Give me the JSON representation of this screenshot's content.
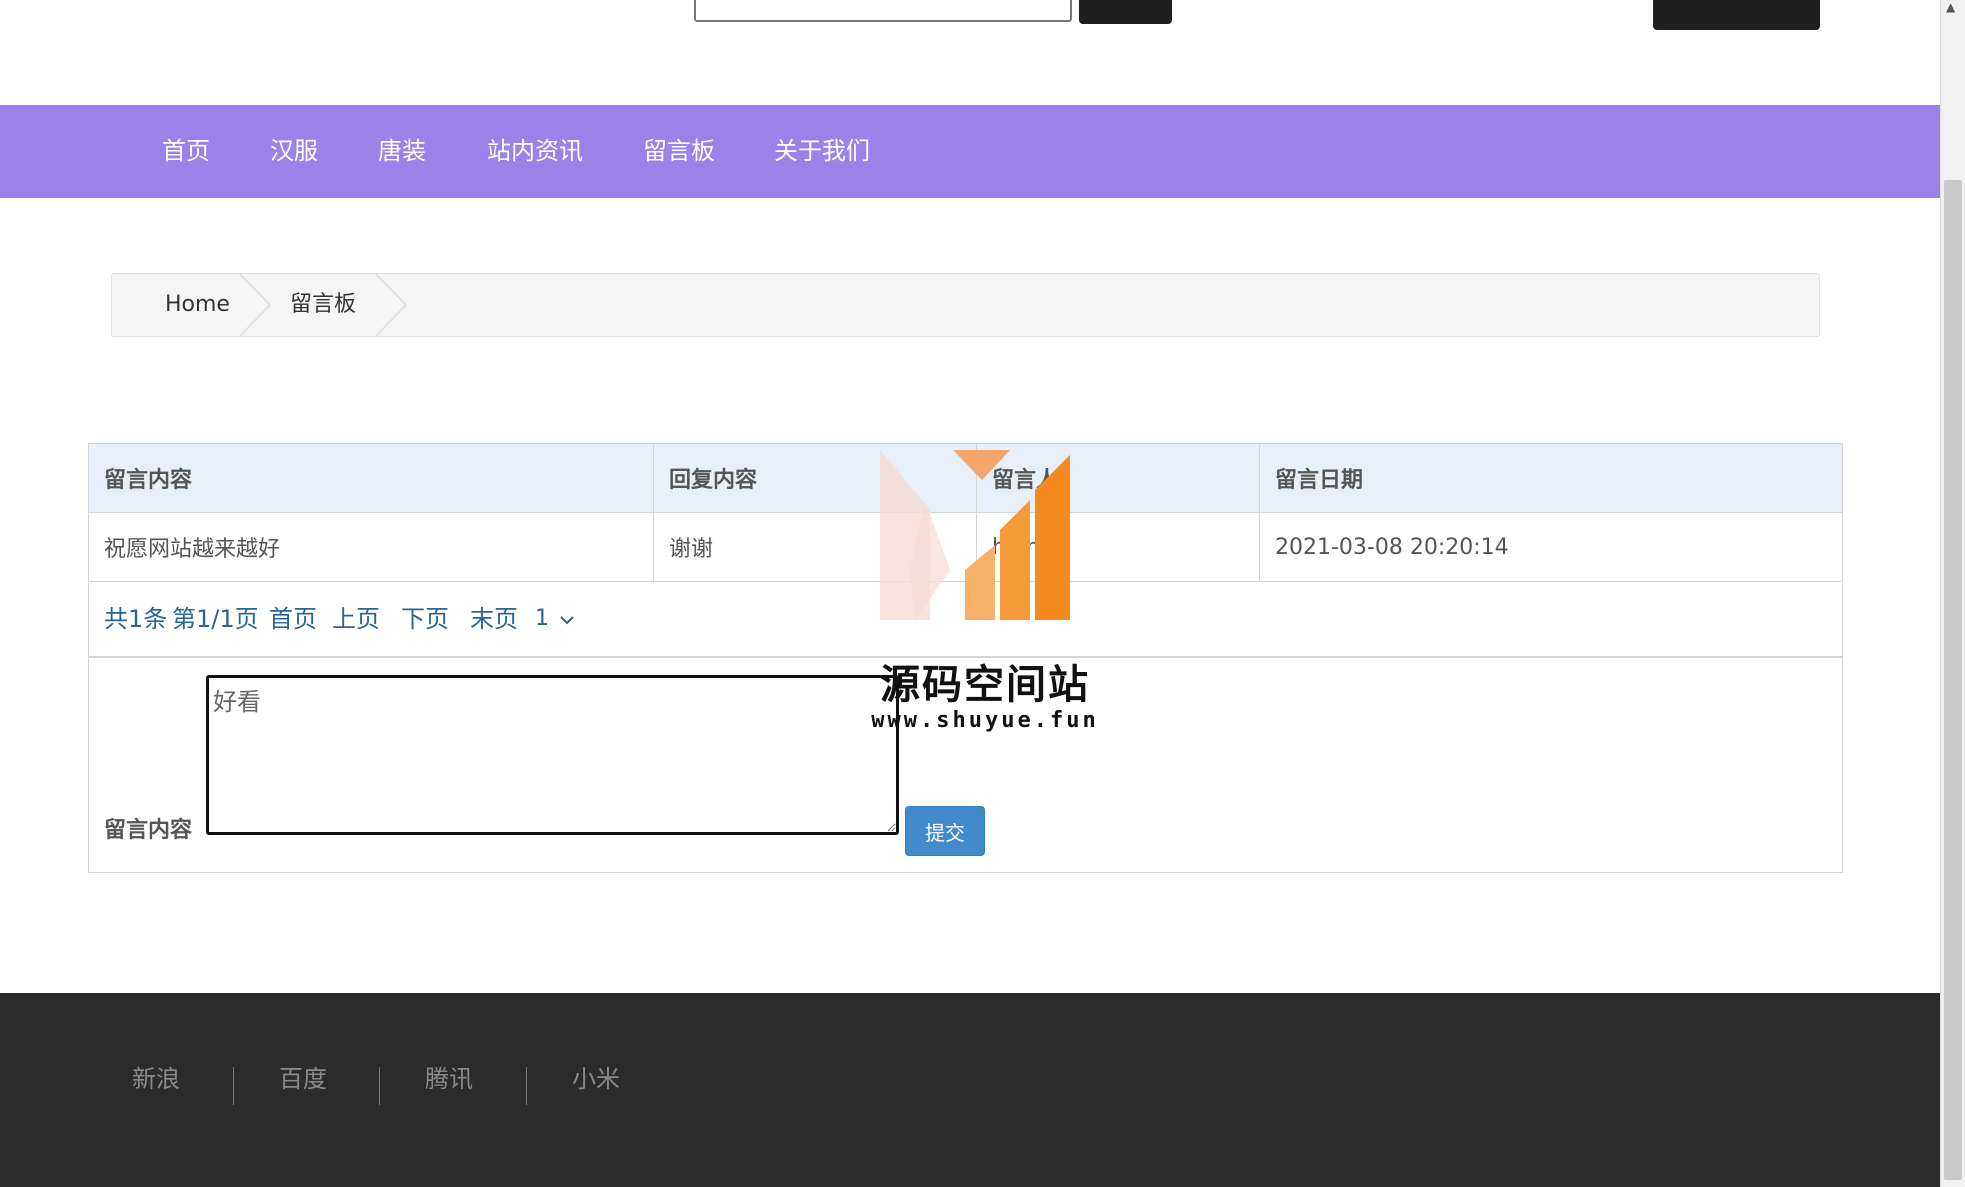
{
  "nav": {
    "items": [
      {
        "label": "首页"
      },
      {
        "label": "汉服"
      },
      {
        "label": "唐装"
      },
      {
        "label": "站内资讯"
      },
      {
        "label": "留言板"
      },
      {
        "label": "关于我们"
      }
    ]
  },
  "breadcrumb": {
    "items": [
      "Home",
      "留言板"
    ]
  },
  "table": {
    "headers": [
      "留言内容",
      "回复内容",
      "留言人",
      "留言日期"
    ],
    "rows": [
      {
        "content": "祝愿网站越来越好",
        "reply": "谢谢",
        "author": "huihui",
        "date": "2021-03-08 20:20:14"
      }
    ]
  },
  "pager": {
    "total": "共1条",
    "page_info": "第1/1页",
    "first": "首页",
    "prev": "上页",
    "next": "下页",
    "last": "末页",
    "selected_page": "1"
  },
  "form": {
    "label": "留言内容",
    "textarea_value": "好看",
    "submit_label": "提交"
  },
  "watermark": {
    "title": "源码空间站",
    "url": "www.shuyue.fun"
  },
  "footer": {
    "links": [
      "新浪",
      "百度",
      "腾讯",
      "小米"
    ]
  },
  "colors": {
    "nav_bg": "#9b82e8",
    "footer_bg": "#2b2b2b",
    "link": "#2a6496",
    "button": "#428bca"
  }
}
